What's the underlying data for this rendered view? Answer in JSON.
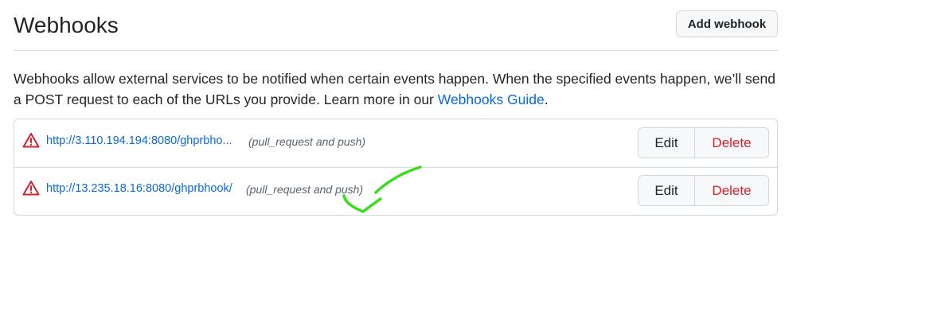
{
  "header": {
    "title": "Webhooks",
    "add_button_label": "Add webhook"
  },
  "description": {
    "text": "Webhooks allow external services to be notified when certain events happen. When the specified events happen, we’ll send a POST request to each of the URLs you provide. Learn more in our ",
    "link_text": "Webhooks Guide",
    "suffix": "."
  },
  "hooks": [
    {
      "url": "http://3.110.194.194:8080/ghprbho...",
      "events": "(pull_request and push)",
      "edit_label": "Edit",
      "delete_label": "Delete"
    },
    {
      "url": "http://13.235.18.16:8080/ghprbhook/",
      "events": "(pull_request and push)",
      "edit_label": "Edit",
      "delete_label": "Delete"
    }
  ],
  "colors": {
    "link": "#0969da",
    "danger": "#cf222e",
    "annotation": "#3ddc1e"
  },
  "icons": {
    "hook_status": "alert-triangle-icon"
  }
}
